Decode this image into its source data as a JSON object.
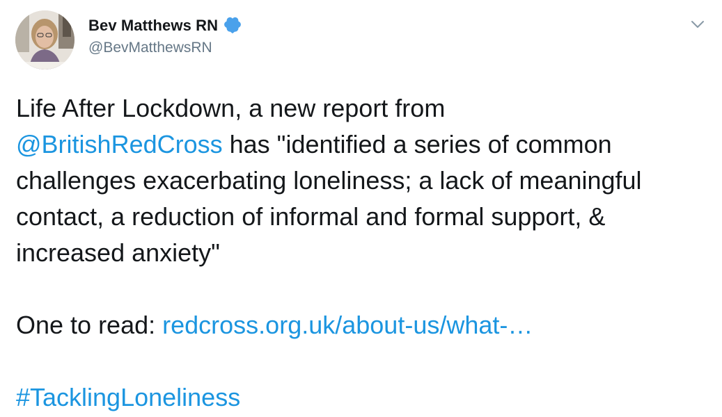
{
  "user": {
    "display_name": "Bev Matthews RN",
    "handle": "@BevMatthewsRN",
    "verified": true,
    "verified_color": "#4aa1eb"
  },
  "icons": {
    "verified": "verified-badge-icon",
    "menu": "chevron-down-icon"
  },
  "tweet": {
    "line1": "Life After Lockdown, a new report from",
    "mention": "@BritishRedCross",
    "line2_rest": " has \"identified a series of common",
    "line3": "challenges exacerbating loneliness; a lack of meaningful",
    "line4": "contact, a reduction of informal and formal support, &",
    "line5": "increased anxiety\"",
    "read_prefix": "One to read: ",
    "url_display": "redcross.org.uk/about-us/what-…",
    "hashtag": "#TacklingLoneliness"
  },
  "colors": {
    "text": "#14171a",
    "secondary": "#657786",
    "link": "#1b95e0"
  }
}
